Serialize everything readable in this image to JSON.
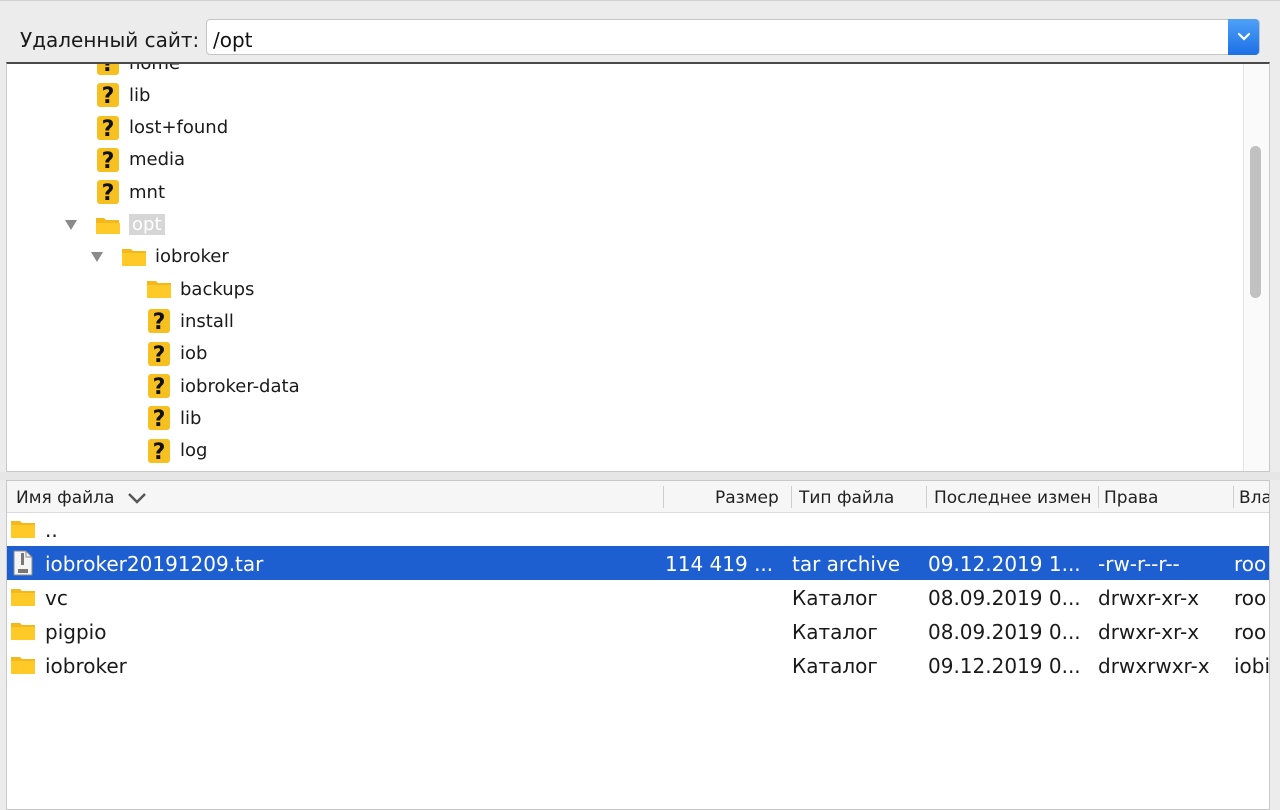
{
  "remote_site": {
    "label": "Удаленный сайт:",
    "path": "/opt"
  },
  "tree": {
    "items": [
      {
        "name": "home",
        "icon": "question-icon",
        "level": 0,
        "partial": true
      },
      {
        "name": "lib",
        "icon": "question-icon",
        "level": 0
      },
      {
        "name": "lost+found",
        "icon": "question-icon",
        "level": 0
      },
      {
        "name": "media",
        "icon": "question-icon",
        "level": 0
      },
      {
        "name": "mnt",
        "icon": "question-icon",
        "level": 0
      },
      {
        "name": "opt",
        "icon": "folder-open-icon",
        "level": 0,
        "expanded": true,
        "selected": true
      },
      {
        "name": "iobroker",
        "icon": "folder-icon",
        "level": 1,
        "expanded": true
      },
      {
        "name": "backups",
        "icon": "folder-icon",
        "level": 2
      },
      {
        "name": "install",
        "icon": "question-icon",
        "level": 2
      },
      {
        "name": "iob",
        "icon": "question-icon",
        "level": 2
      },
      {
        "name": "iobroker-data",
        "icon": "question-icon",
        "level": 2
      },
      {
        "name": "lib",
        "icon": "question-icon",
        "level": 2
      },
      {
        "name": "log",
        "icon": "question-icon",
        "level": 2
      }
    ]
  },
  "file_list": {
    "columns": {
      "name": "Имя файла",
      "size": "Размер",
      "type": "Тип файла",
      "modified": "Последнее измен",
      "perms": "Права",
      "owner": "Вла"
    },
    "rows": [
      {
        "icon": "folder-icon",
        "name": "..",
        "size": "",
        "type": "",
        "modified": "",
        "perms": "",
        "owner": "",
        "selected": false
      },
      {
        "icon": "tar-file-icon",
        "name": "iobroker20191209.tar",
        "size": "114 419 ...",
        "type": "tar archive",
        "modified": "09.12.2019 1...",
        "perms": "-rw-r--r--",
        "owner": "roo",
        "selected": true
      },
      {
        "icon": "folder-icon",
        "name": "vc",
        "size": "",
        "type": "Каталог",
        "modified": "08.09.2019 0...",
        "perms": "drwxr-xr-x",
        "owner": "roo",
        "selected": false
      },
      {
        "icon": "folder-icon",
        "name": "pigpio",
        "size": "",
        "type": "Каталог",
        "modified": "08.09.2019 0...",
        "perms": "drwxr-xr-x",
        "owner": "roo",
        "selected": false
      },
      {
        "icon": "folder-icon",
        "name": "iobroker",
        "size": "",
        "type": "Каталог",
        "modified": "09.12.2019 0...",
        "perms": "drwxrwxr-x",
        "owner": "iobi",
        "selected": false
      }
    ]
  },
  "colors": {
    "selection": "#1d5fd1",
    "folder": "#ffc928",
    "question": "#f5c020",
    "combo_button": "#1d6fe6"
  }
}
